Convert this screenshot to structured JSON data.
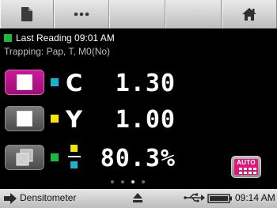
{
  "toolbar": {
    "buttons": [
      {
        "icon": "document-icon"
      },
      {
        "icon": "more-icon"
      },
      {
        "icon": "home-icon"
      }
    ]
  },
  "status": {
    "indicator_color": "#1cb83a",
    "text": "Last Reading 09:01 AM",
    "subtitle": "Trapping: Pap, T, M0(No)"
  },
  "readings": [
    {
      "button_active": true,
      "swatch_color": "#1bb1cf",
      "letter": "C",
      "value": "1.30"
    },
    {
      "button_active": false,
      "swatch_color": "#f6e500",
      "letter": "Y",
      "value": "1.00"
    },
    {
      "button_active": false,
      "swatch_color": "#1cb83a",
      "letter": "",
      "value": "80.3%"
    }
  ],
  "pager": {
    "count": 4,
    "current": 3
  },
  "auto_button": {
    "label": "AUTO"
  },
  "bottom_bar": {
    "mode": "Densitometer",
    "time": "09:14 AM"
  },
  "colors": {
    "accent_magenta": "#cc1a9c",
    "cyan": "#1bb1cf",
    "yellow": "#f6e500",
    "green": "#1cb83a"
  }
}
